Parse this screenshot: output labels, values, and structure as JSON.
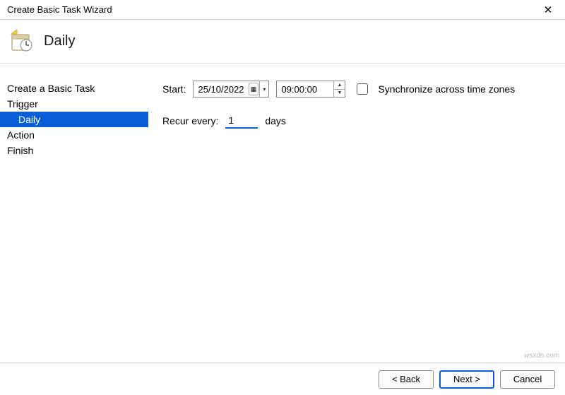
{
  "window": {
    "title": "Create Basic Task Wizard"
  },
  "header": {
    "title": "Daily"
  },
  "sidebar": {
    "items": [
      {
        "label": "Create a Basic Task",
        "sub": false,
        "selected": false
      },
      {
        "label": "Trigger",
        "sub": false,
        "selected": false
      },
      {
        "label": "Daily",
        "sub": true,
        "selected": true
      },
      {
        "label": "Action",
        "sub": false,
        "selected": false
      },
      {
        "label": "Finish",
        "sub": false,
        "selected": false
      }
    ]
  },
  "form": {
    "start_label": "Start:",
    "date_value": "25/10/2022",
    "time_value": "09:00:00",
    "sync_label": "Synchronize across time zones",
    "sync_checked": false,
    "recur_label": "Recur every:",
    "recur_value": "1",
    "recur_unit": "days"
  },
  "footer": {
    "back": "< Back",
    "next": "Next >",
    "cancel": "Cancel"
  },
  "watermark": "wsxdn.com"
}
